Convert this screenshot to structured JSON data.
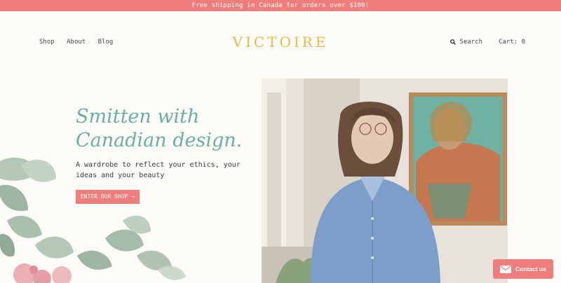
{
  "promo": {
    "text": "Free shipping in Canada for orders over $100!"
  },
  "nav": {
    "left": [
      {
        "label": "Shop"
      },
      {
        "label": "About"
      },
      {
        "label": "Blog"
      }
    ],
    "logo": "VICTOIRE",
    "search_label": "Search",
    "cart_label": "Cart: 0"
  },
  "hero": {
    "headline_line1": "Smitten with",
    "headline_line2": "Canadian design.",
    "subtext_line1": "A wardrobe to reflect your ethics, your",
    "subtext_line2": "ideas and your beauty",
    "cta_label": "ENTER OUR SHOP →"
  },
  "contact": {
    "label": "Contact us",
    "icon": "envelope-icon"
  },
  "colors": {
    "accent": "#ef7d7b",
    "logo": "#e8b84c",
    "headline": "#6aaea6",
    "background": "#fcfbf7"
  }
}
